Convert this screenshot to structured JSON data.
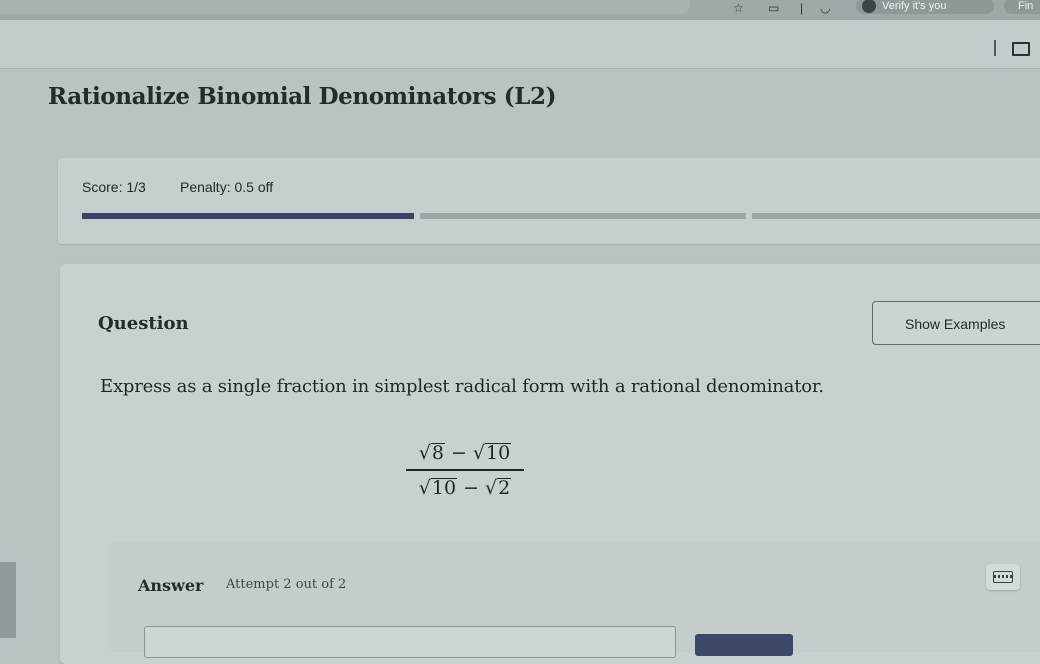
{
  "browser": {
    "verify_text": "Verify it's you",
    "find_text": "Fin"
  },
  "page": {
    "title": "Rationalize Binomial Denominators (L2)"
  },
  "score": {
    "score_text": "Score: 1/3",
    "penalty_text": "Penalty: 0.5 off",
    "progress_segments": 3,
    "completed_segments": 1
  },
  "question": {
    "label": "Question",
    "show_examples_label": "Show Examples",
    "instruction": "Express as a single fraction in simplest radical form with a rational denominator.",
    "numerator": {
      "term1": "8",
      "operator": "−",
      "term2": "10"
    },
    "denominator": {
      "term1": "10",
      "operator": "−",
      "term2": "2"
    }
  },
  "answer": {
    "label": "Answer",
    "attempt_text": "Attempt 2 out of 2",
    "input_value": ""
  }
}
